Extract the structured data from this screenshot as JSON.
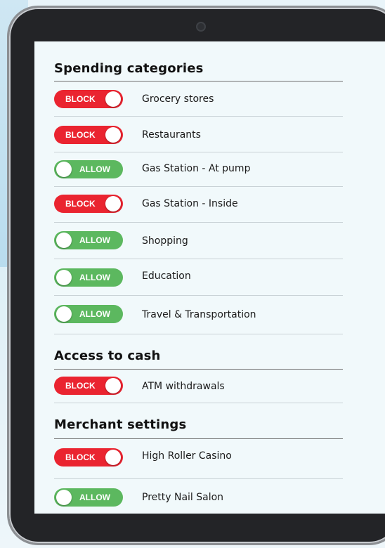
{
  "sections": {
    "spending": {
      "title": "Spending categories"
    },
    "cash": {
      "title": "Access to cash"
    },
    "merchant": {
      "title": "Merchant settings"
    }
  },
  "items": [
    {
      "label": "Grocery stores",
      "state": "BLOCK"
    },
    {
      "label": "Restaurants",
      "state": "BLOCK"
    },
    {
      "label": "Gas Station - At pump",
      "state": "ALLOW"
    },
    {
      "label": "Gas Station - Inside",
      "state": "BLOCK"
    },
    {
      "label": "Shopping",
      "state": "ALLOW"
    },
    {
      "label": "Education",
      "state": "ALLOW"
    },
    {
      "label": "Travel & Transportation",
      "state": "ALLOW"
    },
    {
      "label": "ATM withdrawals",
      "state": "BLOCK"
    },
    {
      "label": "High Roller Casino",
      "state": "BLOCK"
    },
    {
      "label": "Pretty Nail Salon",
      "state": "ALLOW"
    }
  ],
  "colors": {
    "block": "#ea2430",
    "allow": "#5cb85f",
    "screen": "#f1f9fb",
    "bezel": "#232427"
  }
}
